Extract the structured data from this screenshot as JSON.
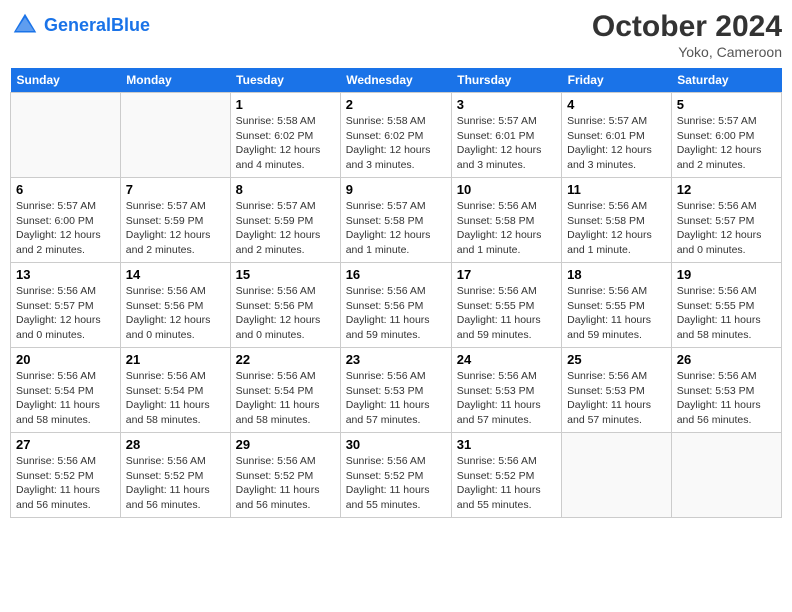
{
  "header": {
    "logo_text_general": "General",
    "logo_text_blue": "Blue",
    "month": "October 2024",
    "location": "Yoko, Cameroon"
  },
  "weekdays": [
    "Sunday",
    "Monday",
    "Tuesday",
    "Wednesday",
    "Thursday",
    "Friday",
    "Saturday"
  ],
  "weeks": [
    [
      {
        "day": "",
        "info": ""
      },
      {
        "day": "",
        "info": ""
      },
      {
        "day": "1",
        "info": "Sunrise: 5:58 AM\nSunset: 6:02 PM\nDaylight: 12 hours and 4 minutes."
      },
      {
        "day": "2",
        "info": "Sunrise: 5:58 AM\nSunset: 6:02 PM\nDaylight: 12 hours and 3 minutes."
      },
      {
        "day": "3",
        "info": "Sunrise: 5:57 AM\nSunset: 6:01 PM\nDaylight: 12 hours and 3 minutes."
      },
      {
        "day": "4",
        "info": "Sunrise: 5:57 AM\nSunset: 6:01 PM\nDaylight: 12 hours and 3 minutes."
      },
      {
        "day": "5",
        "info": "Sunrise: 5:57 AM\nSunset: 6:00 PM\nDaylight: 12 hours and 2 minutes."
      }
    ],
    [
      {
        "day": "6",
        "info": "Sunrise: 5:57 AM\nSunset: 6:00 PM\nDaylight: 12 hours and 2 minutes."
      },
      {
        "day": "7",
        "info": "Sunrise: 5:57 AM\nSunset: 5:59 PM\nDaylight: 12 hours and 2 minutes."
      },
      {
        "day": "8",
        "info": "Sunrise: 5:57 AM\nSunset: 5:59 PM\nDaylight: 12 hours and 2 minutes."
      },
      {
        "day": "9",
        "info": "Sunrise: 5:57 AM\nSunset: 5:58 PM\nDaylight: 12 hours and 1 minute."
      },
      {
        "day": "10",
        "info": "Sunrise: 5:56 AM\nSunset: 5:58 PM\nDaylight: 12 hours and 1 minute."
      },
      {
        "day": "11",
        "info": "Sunrise: 5:56 AM\nSunset: 5:58 PM\nDaylight: 12 hours and 1 minute."
      },
      {
        "day": "12",
        "info": "Sunrise: 5:56 AM\nSunset: 5:57 PM\nDaylight: 12 hours and 0 minutes."
      }
    ],
    [
      {
        "day": "13",
        "info": "Sunrise: 5:56 AM\nSunset: 5:57 PM\nDaylight: 12 hours and 0 minutes."
      },
      {
        "day": "14",
        "info": "Sunrise: 5:56 AM\nSunset: 5:56 PM\nDaylight: 12 hours and 0 minutes."
      },
      {
        "day": "15",
        "info": "Sunrise: 5:56 AM\nSunset: 5:56 PM\nDaylight: 12 hours and 0 minutes."
      },
      {
        "day": "16",
        "info": "Sunrise: 5:56 AM\nSunset: 5:56 PM\nDaylight: 11 hours and 59 minutes."
      },
      {
        "day": "17",
        "info": "Sunrise: 5:56 AM\nSunset: 5:55 PM\nDaylight: 11 hours and 59 minutes."
      },
      {
        "day": "18",
        "info": "Sunrise: 5:56 AM\nSunset: 5:55 PM\nDaylight: 11 hours and 59 minutes."
      },
      {
        "day": "19",
        "info": "Sunrise: 5:56 AM\nSunset: 5:55 PM\nDaylight: 11 hours and 58 minutes."
      }
    ],
    [
      {
        "day": "20",
        "info": "Sunrise: 5:56 AM\nSunset: 5:54 PM\nDaylight: 11 hours and 58 minutes."
      },
      {
        "day": "21",
        "info": "Sunrise: 5:56 AM\nSunset: 5:54 PM\nDaylight: 11 hours and 58 minutes."
      },
      {
        "day": "22",
        "info": "Sunrise: 5:56 AM\nSunset: 5:54 PM\nDaylight: 11 hours and 58 minutes."
      },
      {
        "day": "23",
        "info": "Sunrise: 5:56 AM\nSunset: 5:53 PM\nDaylight: 11 hours and 57 minutes."
      },
      {
        "day": "24",
        "info": "Sunrise: 5:56 AM\nSunset: 5:53 PM\nDaylight: 11 hours and 57 minutes."
      },
      {
        "day": "25",
        "info": "Sunrise: 5:56 AM\nSunset: 5:53 PM\nDaylight: 11 hours and 57 minutes."
      },
      {
        "day": "26",
        "info": "Sunrise: 5:56 AM\nSunset: 5:53 PM\nDaylight: 11 hours and 56 minutes."
      }
    ],
    [
      {
        "day": "27",
        "info": "Sunrise: 5:56 AM\nSunset: 5:52 PM\nDaylight: 11 hours and 56 minutes."
      },
      {
        "day": "28",
        "info": "Sunrise: 5:56 AM\nSunset: 5:52 PM\nDaylight: 11 hours and 56 minutes."
      },
      {
        "day": "29",
        "info": "Sunrise: 5:56 AM\nSunset: 5:52 PM\nDaylight: 11 hours and 56 minutes."
      },
      {
        "day": "30",
        "info": "Sunrise: 5:56 AM\nSunset: 5:52 PM\nDaylight: 11 hours and 55 minutes."
      },
      {
        "day": "31",
        "info": "Sunrise: 5:56 AM\nSunset: 5:52 PM\nDaylight: 11 hours and 55 minutes."
      },
      {
        "day": "",
        "info": ""
      },
      {
        "day": "",
        "info": ""
      }
    ]
  ]
}
